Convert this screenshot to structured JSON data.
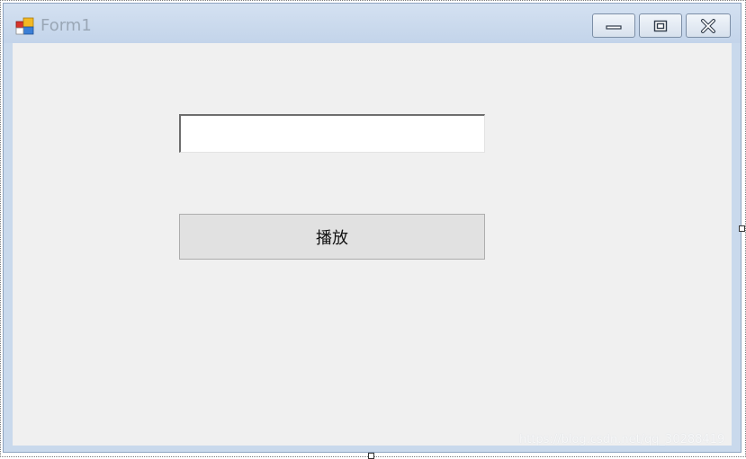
{
  "window": {
    "title": "Form1",
    "icon": "form-app-icon"
  },
  "caption_buttons": {
    "minimize_icon": "minimize-icon",
    "maximize_icon": "maximize-icon",
    "close_icon": "close-icon"
  },
  "form": {
    "textbox": {
      "value": "",
      "placeholder": ""
    },
    "play_button_label": "播放"
  },
  "watermark": "https://blog.csdn.net/qq_30288419",
  "colors": {
    "titlebar": "#c9d9ec",
    "client": "#f0f0f0",
    "button_face": "#e1e1e1",
    "button_border": "#adadad",
    "title_text": "#9aa7b6"
  }
}
